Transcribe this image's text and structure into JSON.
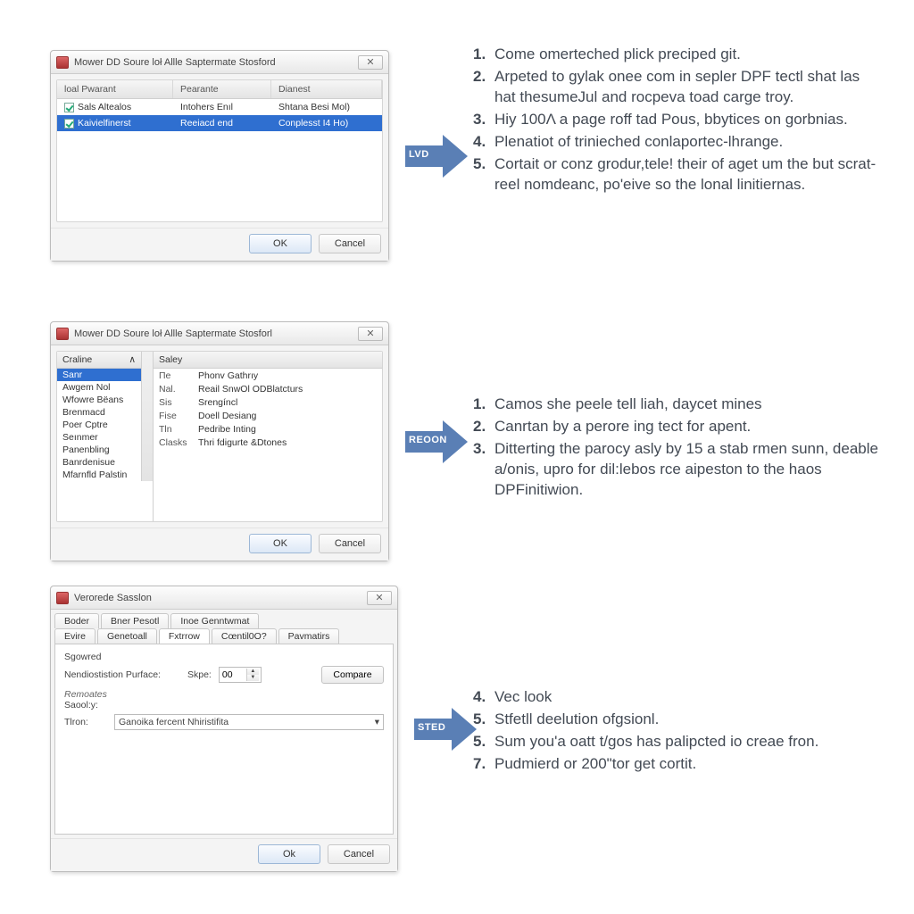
{
  "arrows": {
    "a1": "LVD",
    "a2": "REOON",
    "a3": "STED"
  },
  "buttons": {
    "ok": "OK",
    "ok2": "Ok",
    "cancel": "Cancel",
    "compare": "Compare"
  },
  "close_glyph": "✕",
  "dialog1": {
    "title": "Mower DD Soure loł Allle Saptermate Stosford",
    "headers": {
      "c1": "loal Pwarant",
      "c2": "Pearante",
      "c3": "Dianest"
    },
    "rows": [
      {
        "c1": "Sals Altealos",
        "c2": "Intohers Enıl",
        "c3": "Shtana Besi Mol)"
      },
      {
        "c1": "Kaivielfinerst",
        "c2": "Reeiacd end",
        "c3": "Conplesst I4 Ho)"
      }
    ]
  },
  "dialog2": {
    "title": "Mower DD Soure loł Allle Saptermate Stosforl",
    "list_header": "Craline",
    "sort_ind": "∧",
    "items": [
      "Sanr",
      "Awgem Nol",
      "Wfowre Bëans",
      "Brenmacd",
      "Poer Cptre",
      "Seınmer",
      "Panenbling",
      "Banrdenisue",
      "Mfarnfld Palstin"
    ],
    "kv_header": "Saley",
    "kv": [
      {
        "k": "Пe",
        "v": "Phonv Gathrıy"
      },
      {
        "k": "Nal.",
        "v": "Reail SnwOl ODBlatcturs"
      },
      {
        "k": "Sis",
        "v": "Srengíncl"
      },
      {
        "k": "Fise",
        "v": "Doell Desiang"
      },
      {
        "k": "Tln",
        "v": "Pedribe Inting"
      },
      {
        "k": "Clasks",
        "v": "Thri fdigurte &Dtones"
      }
    ]
  },
  "dialog3": {
    "title": "Verorede Sasslon",
    "tabs_row1": [
      "Boder",
      "Bner Pesotl",
      "Inoe Genntwmat"
    ],
    "tabs_row2": [
      "Evire",
      "Genetoall",
      "Fxtrrow",
      "Cœntil0O?",
      "Pavmatirs"
    ],
    "active_tab_index": 2,
    "section1": "Sgowred",
    "field1_label": "Nendiostistion Purface:",
    "field1_sub": "Skpe:",
    "field1_val": "00",
    "section2": "Remoates",
    "section2b": "Saool:y:",
    "combo_label": "Tlron:",
    "combo_value": "Ganoika fercent Nhiristifita"
  },
  "instructions1": [
    {
      "n": "1.",
      "t": "Come omerteched plick preciped git."
    },
    {
      "n": "2.",
      "t": "Arpeted to gylak onee com in sepler DPF tectl shat las hat thesumeJul and rocpeva toad carge troy."
    },
    {
      "n": "3.",
      "t": "Hiy 100Λ a page roff tad Pous, bbytices on gorbnias."
    },
    {
      "n": "4.",
      "t": "Plenatiot of trinieched conlaportec-lhrange."
    },
    {
      "n": "5.",
      "t": "Cortait or conz grodur,tele! their of aget um the but scrat-reel nomdeanc, po'eive so the lonal linitiernas."
    }
  ],
  "instructions2": [
    {
      "n": "1.",
      "t": "Camos she peele tell liah, daycet mines"
    },
    {
      "n": "2.",
      "t": "Canrtan by a perore ing tect for apent."
    },
    {
      "n": "3.",
      "t": "Ditterting the parocy asly by 15 a stab rmen sunn, deable a/onis, upro for dil:lebos rce aipeston to the haos DPFinitiwion."
    }
  ],
  "instructions3": [
    {
      "n": "4.",
      "t": "Vec look"
    },
    {
      "n": "5.",
      "t": "Stfetll deelution ofgsionl."
    },
    {
      "n": "5.",
      "t": "Sum you'a oatt t/gos has palipcted io creae fron."
    },
    {
      "n": "7.",
      "t": "Pudmierd or 200\"tor get cortit."
    }
  ]
}
